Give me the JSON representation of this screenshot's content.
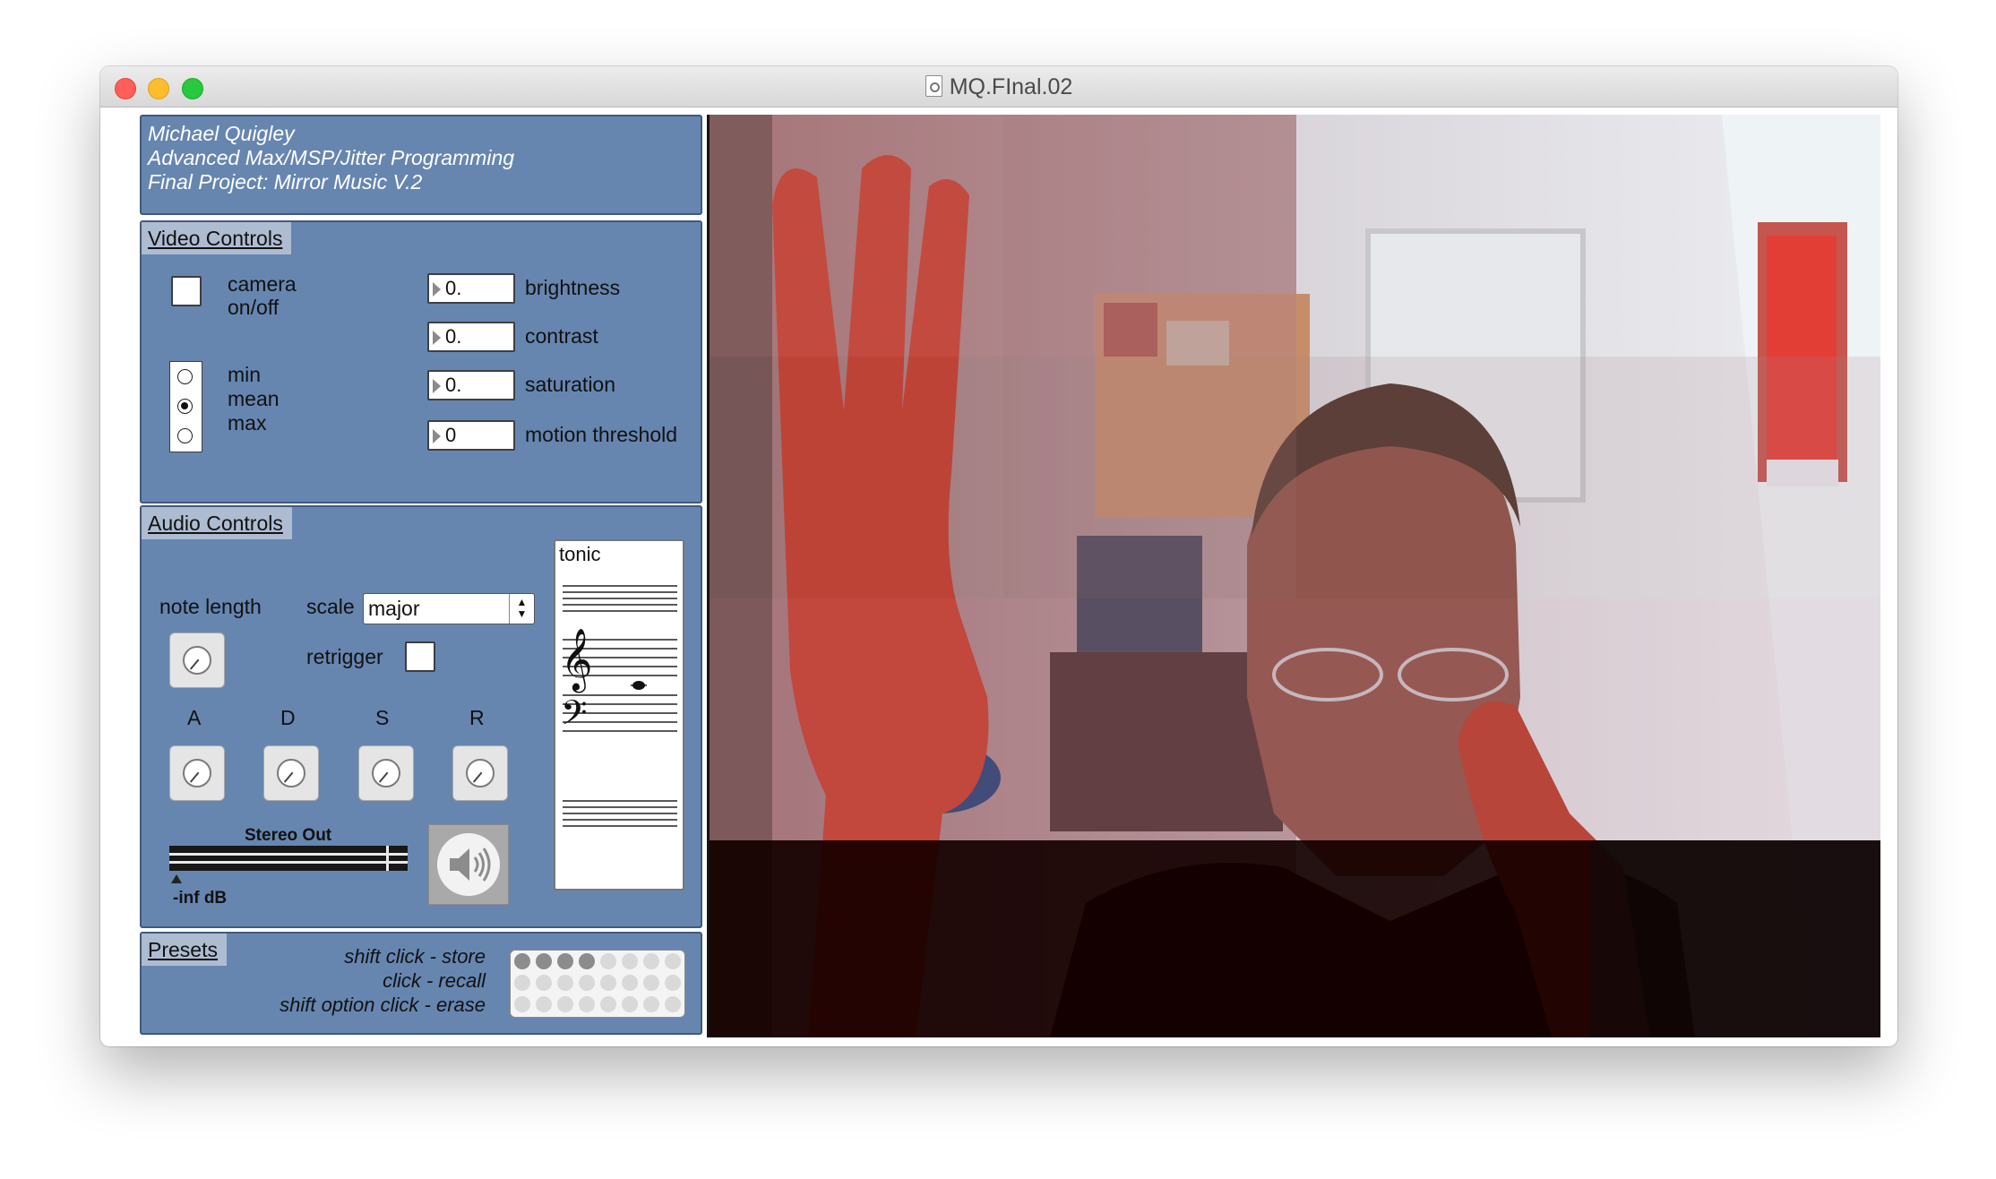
{
  "window": {
    "title": "MQ.FInal.02"
  },
  "credits": {
    "line1": "Michael Quigley",
    "line2": "Advanced Max/MSP/Jitter Programming",
    "line3": "Final Project: Mirror Music V.2"
  },
  "video_controls": {
    "title": "Video Controls",
    "camera_label_1": "camera",
    "camera_label_2": "on/off",
    "camera_on": false,
    "modes": [
      "min",
      "mean",
      "max"
    ],
    "selected_mode": "mean",
    "params": [
      {
        "value": "0.",
        "label": "brightness"
      },
      {
        "value": "0.",
        "label": "contrast"
      },
      {
        "value": "0.",
        "label": "saturation"
      },
      {
        "value": "0",
        "label": "motion threshold"
      }
    ]
  },
  "audio_controls": {
    "title": "Audio Controls",
    "note_length_label": "note length",
    "scale_label": "scale",
    "scale_value": "major",
    "retrigger_label": "retrigger",
    "retrigger_on": false,
    "adsr": [
      "A",
      "D",
      "S",
      "R"
    ],
    "output_label": "Stereo Out",
    "output_level": "-inf dB",
    "staff_title": "tonic"
  },
  "presets": {
    "title": "Presets",
    "hint1": "shift click - store",
    "hint2": "click - recall",
    "hint3": "shift option click - erase",
    "slots_used": 4,
    "slots_total": 24
  },
  "icons": {
    "camera_toggle": "checkbox",
    "speaker": "speaker-icon",
    "document": "document-icon"
  }
}
